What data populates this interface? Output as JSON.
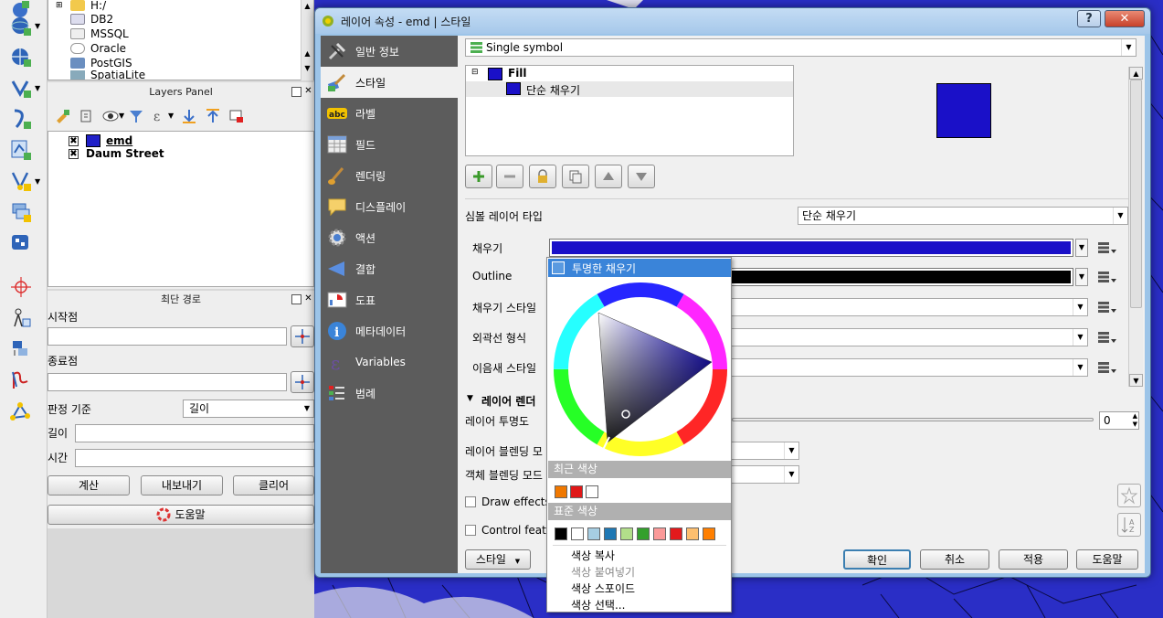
{
  "browser_tree": {
    "items": [
      "H:/",
      "DB2",
      "MSSQL",
      "Oracle",
      "PostGIS",
      "SpatiaLite"
    ]
  },
  "layers_panel": {
    "title": "Layers Panel",
    "layers": [
      {
        "name": "emd",
        "checked": true,
        "swatch": "#2020c8"
      },
      {
        "name": "Daum Street",
        "checked": true
      }
    ]
  },
  "path_panel": {
    "title": "최단 경로",
    "start_label": "시작점",
    "end_label": "종료점",
    "criterion_label": "판정 기준",
    "criterion_value": "길이",
    "length_label": "길이",
    "time_label": "시간",
    "calc_button": "계산",
    "export_button": "내보내기",
    "clear_button": "클리어",
    "help_button": "도움말"
  },
  "dialog": {
    "title": "레이어 속성 - emd | 스타일",
    "help_btn": "?",
    "close_btn": "✕",
    "nav": [
      {
        "label": "일반 정보",
        "icon": "tools-icon"
      },
      {
        "label": "스타일",
        "icon": "brush-icon",
        "active": true
      },
      {
        "label": "라벨",
        "icon": "label-abc-icon"
      },
      {
        "label": "필드",
        "icon": "table-icon"
      },
      {
        "label": "렌더링",
        "icon": "paintbrush-icon"
      },
      {
        "label": "디스플레이",
        "icon": "speech-bubble-icon"
      },
      {
        "label": "액션",
        "icon": "gear-icon"
      },
      {
        "label": "결합",
        "icon": "join-icon"
      },
      {
        "label": "도표",
        "icon": "chart-icon"
      },
      {
        "label": "메타데이터",
        "icon": "info-icon"
      },
      {
        "label": "Variables",
        "icon": "epsilon-icon"
      },
      {
        "label": "범례",
        "icon": "legend-icon"
      }
    ],
    "renderer_select": "Single symbol",
    "symbol_tree": {
      "root": "Fill",
      "child": "단순 채우기"
    },
    "symbol_layer_type_label": "심볼 레이어 타입",
    "symbol_layer_type_value": "단순 채우기",
    "fill_label": "채우기",
    "outline_label": "Outline",
    "fill_style_label": "채우기 스타일",
    "outline_style_label": "외곽선 형식",
    "join_style_label": "이음새 스타일",
    "layer_render_label": "레이어 렌더",
    "layer_opacity_label": "레이어 투명도",
    "opacity_value": "0",
    "layer_blend_label": "레이어 블렌딩 모",
    "feature_blend_label": "객체 블렌딩 모드",
    "draw_effects_label": "Draw effects",
    "control_feature_label": "Control featur",
    "style_button": "스타일",
    "ok_button": "확인",
    "cancel_button": "취소",
    "apply_button": "적용",
    "help_button": "도움말",
    "fill_color": "#1a10c8",
    "outline_color": "#000000"
  },
  "color_popup": {
    "transparent_label": "투명한 채우기",
    "recent_header": "최근 색상",
    "recent_colors": [
      "#f07800",
      "#e01818",
      "#ffffff"
    ],
    "standard_header": "표준 색상",
    "standard_colors": [
      "#000000",
      "#ffffff",
      "#a6cee3",
      "#1f78b4",
      "#b2df8a",
      "#33a02c",
      "#fb9a99",
      "#e31a1c",
      "#fdbf6f",
      "#ff7f00"
    ],
    "copy_color": "색상 복사",
    "paste_color": "색상 붙여넣기",
    "pick_color": "색상 스포이드",
    "choose_color": "색상 선택..."
  }
}
